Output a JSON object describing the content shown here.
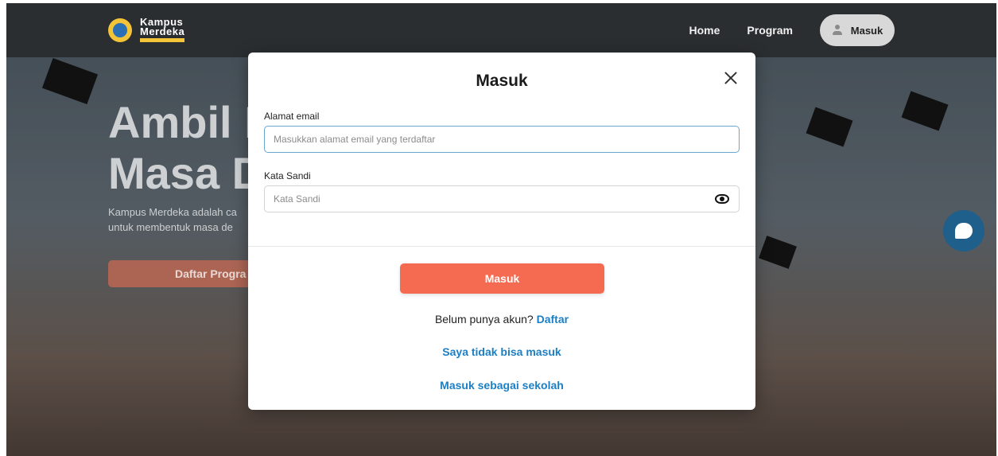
{
  "navbar": {
    "logo_line1": "Kampus",
    "logo_line2": "Merdeka",
    "links": [
      "Home",
      "Program"
    ],
    "login_label": "Masuk"
  },
  "hero": {
    "title_line1": "Ambil I",
    "title_line2": "Masa D",
    "subtitle_line1": "Kampus Merdeka adalah ca",
    "subtitle_line2": "untuk membentuk masa de",
    "button_label": "Daftar Progra"
  },
  "modal": {
    "title": "Masuk",
    "email_label": "Alamat email",
    "email_placeholder": "Masukkan alamat email yang terdaftar",
    "email_value": "",
    "password_label": "Kata Sandi",
    "password_placeholder": "Kata Sandi",
    "password_value": "",
    "submit_label": "Masuk",
    "no_account_text": "Belum punya akun?",
    "signup_link": "Daftar",
    "cannot_login_link": "Saya tidak bisa masuk",
    "school_login_link": "Masuk sebagai sekolah"
  },
  "colors": {
    "accent": "#f46b52",
    "link": "#1c7fc4",
    "chat": "#1f5f8c"
  },
  "icons": [
    "kampus-merdeka-logo",
    "user-icon",
    "close-icon",
    "eye-icon",
    "chat-icon"
  ]
}
